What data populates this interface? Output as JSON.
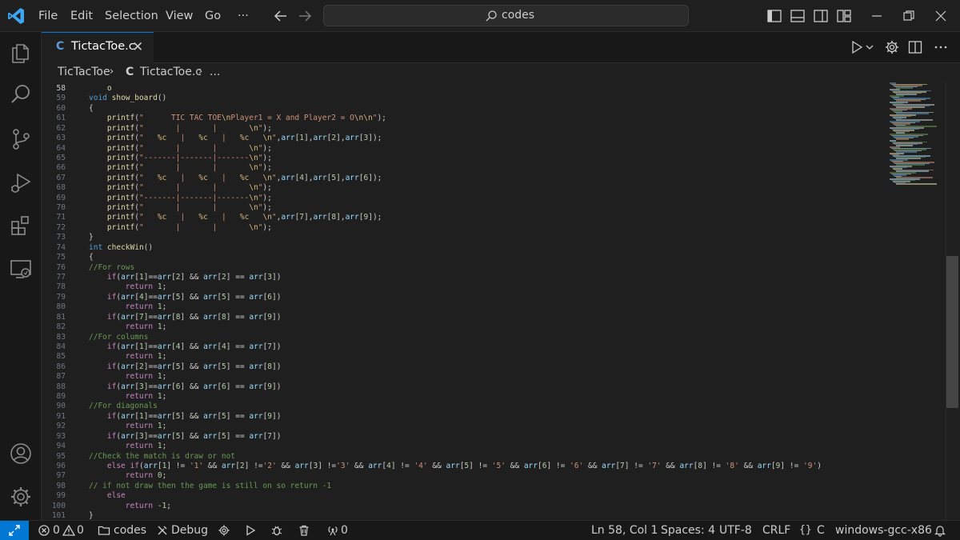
{
  "titlebar": {
    "menu": [
      "File",
      "Edit",
      "Selection",
      "View",
      "Go",
      "···"
    ],
    "search_text": "codes"
  },
  "tabs": [
    {
      "label": "TictacToe.c",
      "close": "✕"
    }
  ],
  "breadcrumb": {
    "folder": "TicTacToe",
    "file": "TictacToe.c",
    "rest": "..."
  },
  "editor": {
    "active_line": 58,
    "lines": [
      {
        "n": 58,
        "code": "    \u001e"
      },
      {
        "n": 59,
        "code": "void show_board()"
      },
      {
        "n": 60,
        "code": "{"
      },
      {
        "n": 61,
        "code": "    printf(\"      TIC TAC TOE\\nPlayer1 = X and Player2 = O\\n\\n\");"
      },
      {
        "n": 62,
        "code": "    printf(\"       |       |       \\n\");"
      },
      {
        "n": 63,
        "code": "    printf(\"   %c   |   %c   |   %c   \\n\",arr[1],arr[2],arr[3]);"
      },
      {
        "n": 64,
        "code": "    printf(\"       |       |       \\n\");"
      },
      {
        "n": 65,
        "code": "    printf(\"-------|-------|-------\\n\");"
      },
      {
        "n": 66,
        "code": "    printf(\"       |       |       \\n\");"
      },
      {
        "n": 67,
        "code": "    printf(\"   %c   |   %c   |   %c   \\n\",arr[4],arr[5],arr[6]);"
      },
      {
        "n": 68,
        "code": "    printf(\"       |       |       \\n\");"
      },
      {
        "n": 69,
        "code": "    printf(\"-------|-------|-------\\n\");"
      },
      {
        "n": 70,
        "code": "    printf(\"       |       |       \\n\");"
      },
      {
        "n": 71,
        "code": "    printf(\"   %c   |   %c   |   %c   \\n\",arr[7],arr[8],arr[9]);"
      },
      {
        "n": 72,
        "code": "    printf(\"       |       |       \\n\");"
      },
      {
        "n": 73,
        "code": "}"
      },
      {
        "n": 74,
        "code": "int checkWin()"
      },
      {
        "n": 75,
        "code": "{"
      },
      {
        "n": 76,
        "code": "//For rows"
      },
      {
        "n": 77,
        "code": "    if(arr[1]==arr[2] && arr[2] == arr[3])"
      },
      {
        "n": 78,
        "code": "        return 1;"
      },
      {
        "n": 79,
        "code": "    if(arr[4]==arr[5] && arr[5] == arr[6])"
      },
      {
        "n": 80,
        "code": "        return 1;"
      },
      {
        "n": 81,
        "code": "    if(arr[7]==arr[8] && arr[8] == arr[9])"
      },
      {
        "n": 82,
        "code": "        return 1;"
      },
      {
        "n": 83,
        "code": "//For columns"
      },
      {
        "n": 84,
        "code": "    if(arr[1]==arr[4] && arr[4] == arr[7])"
      },
      {
        "n": 85,
        "code": "        return 1;"
      },
      {
        "n": 86,
        "code": "    if(arr[2]==arr[5] && arr[5] == arr[8])"
      },
      {
        "n": 87,
        "code": "        return 1;"
      },
      {
        "n": 88,
        "code": "    if(arr[3]==arr[6] && arr[6] == arr[9])"
      },
      {
        "n": 89,
        "code": "        return 1;"
      },
      {
        "n": 90,
        "code": "//For diagonals"
      },
      {
        "n": 91,
        "code": "    if(arr[1]==arr[5] && arr[5] == arr[9])"
      },
      {
        "n": 92,
        "code": "        return 1;"
      },
      {
        "n": 93,
        "code": "    if(arr[3]==arr[5] && arr[5] == arr[7])"
      },
      {
        "n": 94,
        "code": "        return 1;"
      },
      {
        "n": 95,
        "code": "//Check the match is draw or not"
      },
      {
        "n": 96,
        "code": "    else if(arr[1] != '1' && arr[2] !='2' && arr[3] !='3' && arr[4] != '4' && arr[5] != '5' && arr[6] != '6' && arr[7] != '7' && arr[8] != '8' && arr[9] != '9')"
      },
      {
        "n": 97,
        "code": "        return 0;"
      },
      {
        "n": 98,
        "code": "// if not draw then the game is still on so return -1"
      },
      {
        "n": 99,
        "code": "    else"
      },
      {
        "n": 100,
        "code": "        return -1;"
      },
      {
        "n": 101,
        "code": "}"
      }
    ]
  },
  "statusbar": {
    "problems": "0",
    "warnings": "0",
    "folder": "codes",
    "debug": "Debug",
    "ports": "0",
    "position": "Ln 58, Col 1",
    "spaces": "Spaces: 4",
    "encoding": "UTF-8",
    "eol": "CRLF",
    "language": "C",
    "config": "windows-gcc-x86"
  },
  "colors": {
    "accent": "#0078d4",
    "keyword": "#569cd6",
    "control": "#c586c0",
    "function": "#dcdcaa",
    "string": "#ce9178",
    "variable": "#9cdcfe",
    "number": "#b5cea8",
    "comment": "#6a9955"
  }
}
